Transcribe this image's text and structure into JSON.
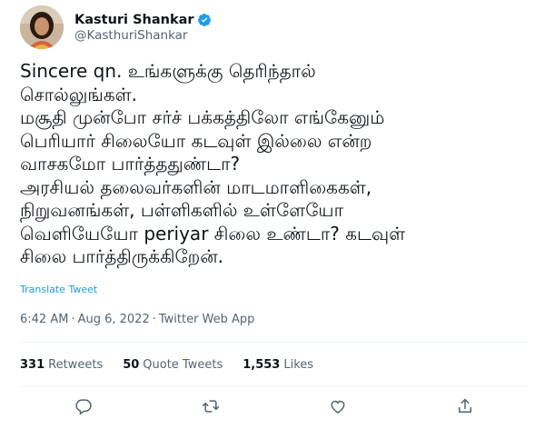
{
  "author": {
    "name": "Kasturi Shankar",
    "handle": "@KasthuriShankar",
    "verified": true
  },
  "tweet": {
    "lines": [
      "Sincere qn. உங்களுக்கு தெரிந்தால்",
      "சொல்லுங்கள்.",
      "மசூதி முன்போ சர்ச் பக்கத்திலோ எங்கேனும்",
      "பெரியார் சிலையோ கடவுள் இல்லை என்ற",
      "வாசகமோ பார்த்ததுண்டா?",
      "அரசியல் தலைவர்களின் மாடமாளிகைகள்,",
      "நிறுவனங்கள், பள்ளிகளில் உள்ளேயோ",
      "வெளியேயோ periyar சிலை உண்டா? கடவுள்",
      "சிலை பார்த்திருக்கிறேன்."
    ],
    "translate_label": "Translate Tweet",
    "time": "6:42 AM",
    "date": "Aug 6, 2022",
    "source": "Twitter Web App",
    "separator": "·"
  },
  "stats": {
    "retweets_count": "331",
    "retweets_label": "Retweets",
    "quotes_count": "50",
    "quotes_label": "Quote Tweets",
    "likes_count": "1,553",
    "likes_label": "Likes"
  },
  "icons": {
    "reply": "reply-icon",
    "retweet": "retweet-icon",
    "like": "like-icon",
    "share": "share-icon",
    "verified": "verified-badge-icon"
  },
  "colors": {
    "accent": "#1d9bf0",
    "text": "#0f1419",
    "muted": "#536471"
  }
}
